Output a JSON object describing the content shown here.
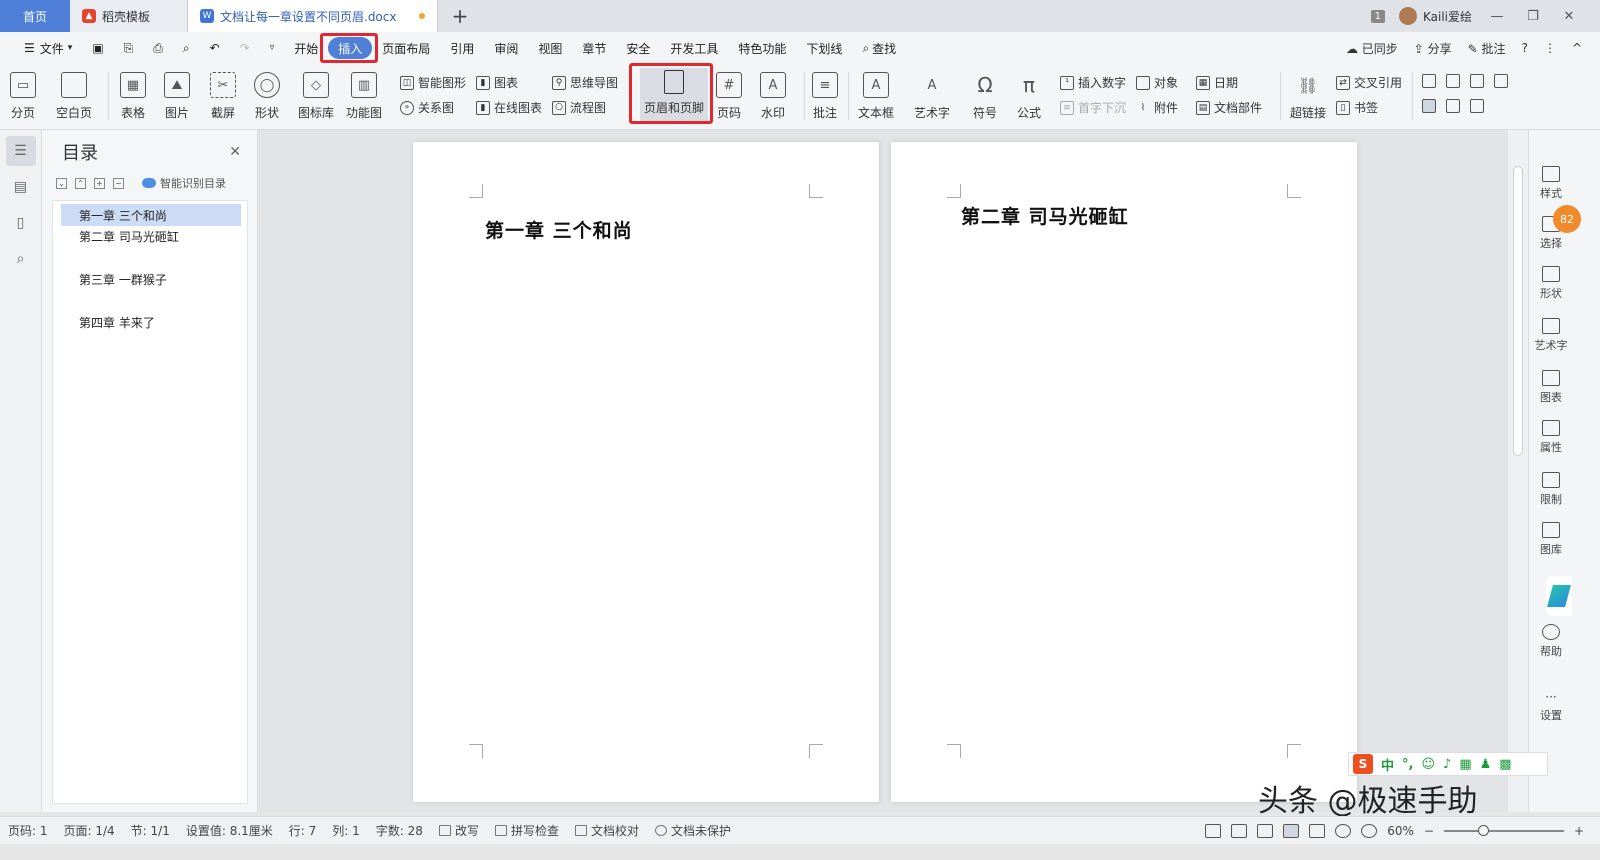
{
  "titlebar": {
    "home_tab": "首页",
    "template_tab": "稻壳模板",
    "doc_tab": "文档让每一章设置不同页眉.docx",
    "new_tab": "+",
    "window_count": "1",
    "username": "Kaili爱绘",
    "minimize": "—",
    "restore": "❐",
    "close": "✕"
  },
  "menubar": {
    "file": "文件",
    "items": [
      "开始",
      "插入",
      "页面布局",
      "引用",
      "审阅",
      "视图",
      "章节",
      "安全",
      "开发工具",
      "特色功能",
      "下划线"
    ],
    "active_item": "插入",
    "search": "查找",
    "sync": "已同步",
    "share": "分享",
    "comment": "批注",
    "help": "?",
    "more": "⋮",
    "collapse": "^"
  },
  "ribbon": {
    "page_break": "分页",
    "blank_page": "空白页",
    "table": "表格",
    "picture": "图片",
    "screenshot": "截屏",
    "shape": "形状",
    "icon_lib": "图标库",
    "function_chart": "功能图",
    "smart_art": "智能图形",
    "chart": "图表",
    "relation": "关系图",
    "online_chart": "在线图表",
    "mind_map": "思维导图",
    "flow_chart": "流程图",
    "header_footer": "页眉和页脚",
    "page_number": "页码",
    "watermark": "水印",
    "annotation": "批注",
    "text_box": "文本框",
    "art_text": "艺术字",
    "symbol": "符号",
    "formula": "公式",
    "insert_number": "插入数字",
    "object": "对象",
    "date": "日期",
    "drop_cap": "首字下沉",
    "attachment": "附件",
    "doc_parts": "文档部件",
    "hyperlink": "超链接",
    "cross_ref": "交叉引用",
    "bookmark": "书签"
  },
  "outline": {
    "title": "目录",
    "smart_toc": "智能识别目录",
    "items": [
      "第一章  三个和尚",
      "第二章  司马光砸缸",
      "第三章  一群猴子",
      "第四章  羊来了"
    ]
  },
  "pages": [
    {
      "heading": "第一章  三个和尚"
    },
    {
      "heading": "第二章  司马光砸缸"
    }
  ],
  "right_panel": {
    "items": [
      "样式",
      "选择",
      "形状",
      "艺术字",
      "图表",
      "属性",
      "限制",
      "图库",
      "帮助",
      "设置"
    ],
    "badge": "82"
  },
  "ime": {
    "brand": "S",
    "mode": "中"
  },
  "watermark": "头条 @极速手助",
  "status": {
    "page_num": "页码: 1",
    "pages": "页面: 1/4",
    "section": "节: 1/1",
    "setting": "设置值: 8.1厘米",
    "row": "行: 7",
    "col": "列: 1",
    "words": "字数: 28",
    "revise": "改写",
    "spell": "拼写检查",
    "proof": "文档校对",
    "protect": "文档未保护",
    "zoom": "60%",
    "zoom_minus": "−",
    "zoom_plus": "+"
  }
}
